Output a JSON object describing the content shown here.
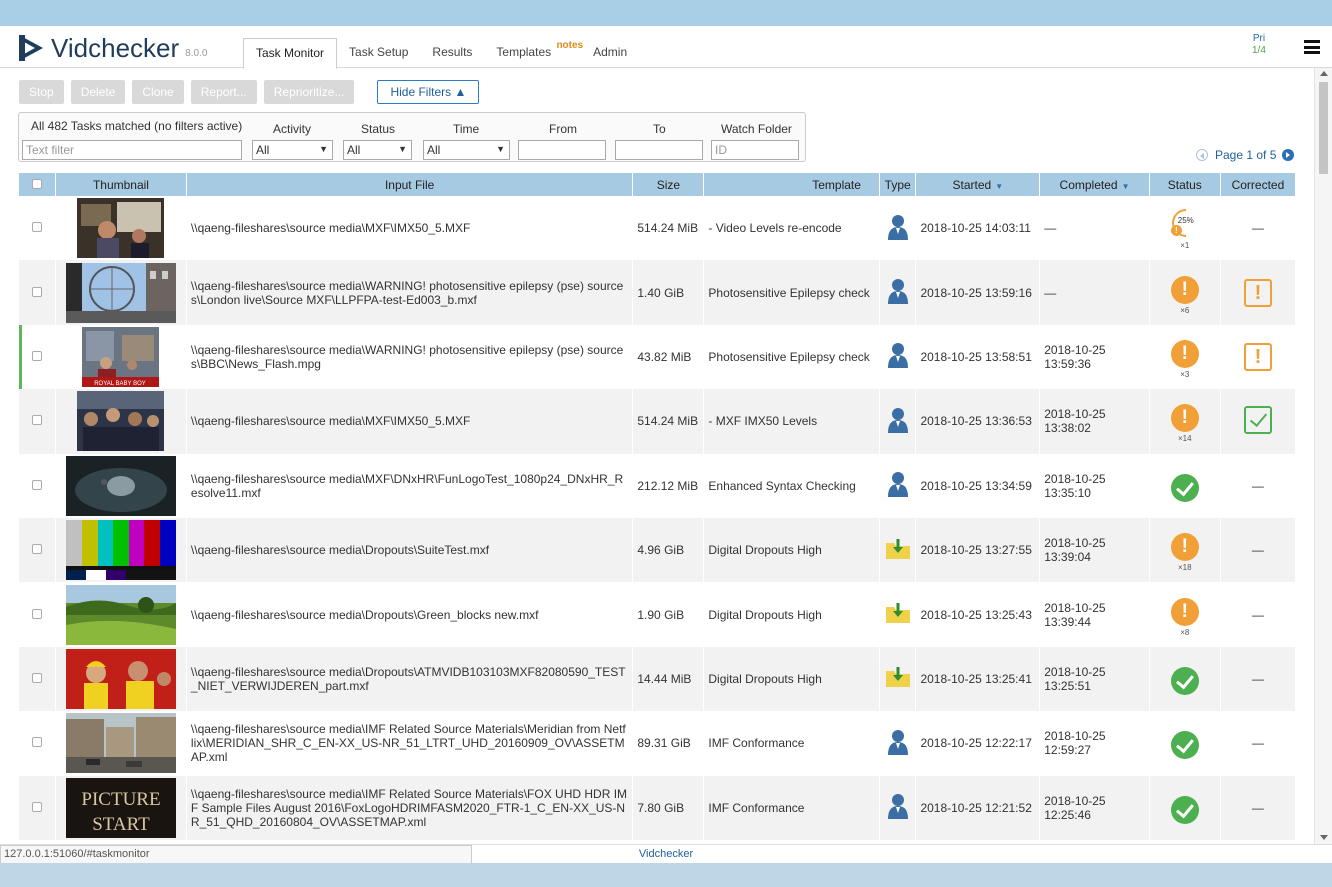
{
  "app": {
    "name": "Vidchecker",
    "version": "8.0.0",
    "priority_label": "Pri",
    "priority_value": "1/4"
  },
  "tabs": [
    {
      "label": "Task Monitor",
      "active": true
    },
    {
      "label": "Task Setup"
    },
    {
      "label": "Results"
    },
    {
      "label": "Templates",
      "badge": "notes"
    },
    {
      "label": "Admin"
    }
  ],
  "toolbar": {
    "stop": "Stop",
    "delete": "Delete",
    "clone": "Clone",
    "report": "Report...",
    "reprioritize": "Reprioritize...",
    "hide_filters": "Hide Filters ▲"
  },
  "filters": {
    "summary": "All 482 Tasks matched (no filters active)",
    "text_placeholder": "Text filter",
    "activity_label": "Activity",
    "activity_value": "All",
    "status_label": "Status",
    "status_value": "All",
    "time_label": "Time",
    "time_value": "All",
    "from_label": "From",
    "from_value": "",
    "to_label": "To",
    "to_value": "",
    "watch_folder_label": "Watch Folder",
    "watch_folder_placeholder": "ID"
  },
  "pager": {
    "text": "Page 1 of 5"
  },
  "columns": {
    "thumbnail": "Thumbnail",
    "input_file": "Input File",
    "size": "Size",
    "template": "Template",
    "type": "Type",
    "started": "Started",
    "completed": "Completed",
    "status": "Status",
    "corrected": "Corrected"
  },
  "rows": [
    {
      "file": "\\\\qaeng-fileshares\\source media\\MXF\\IMX50_5.MXF",
      "size": "514.24 MiB",
      "template": "- Video Levels re-encode",
      "type": "user",
      "started": "2018-10-25 14:03:11",
      "completed": "—",
      "status": "progress",
      "status_pct": "25%",
      "status_count": "×1",
      "corrected": "—",
      "thumb": "office"
    },
    {
      "file": "\\\\qaeng-fileshares\\source media\\WARNING! photosensitive epilepsy (pse) sources\\London live\\Source MXF\\LLPFPA-test-Ed003_b.mxf",
      "size": "1.40 GiB",
      "template": "Photosensitive Epilepsy check",
      "type": "user",
      "started": "2018-10-25 13:59:16",
      "completed": "—",
      "status": "warn",
      "status_count": "×6",
      "corrected": "warn",
      "thumb": "london"
    },
    {
      "file": "\\\\qaeng-fileshares\\source media\\WARNING! photosensitive epilepsy (pse) sources\\BBC\\News_Flash.mpg",
      "size": "43.82 MiB",
      "template": "Photosensitive Epilepsy check",
      "type": "user",
      "started": "2018-10-25 13:58:51",
      "completed": "2018-10-25 13:59:36",
      "status": "warn",
      "status_count": "×3",
      "corrected": "warn",
      "thumb": "news"
    },
    {
      "file": "\\\\qaeng-fileshares\\source media\\MXF\\IMX50_5.MXF",
      "size": "514.24 MiB",
      "template": "- MXF IMX50 Levels",
      "type": "user",
      "started": "2018-10-25 13:36:53",
      "completed": "2018-10-25 13:38:02",
      "status": "warn",
      "status_count": "×14",
      "corrected": "ok",
      "thumb": "crowd"
    },
    {
      "file": "\\\\qaeng-fileshares\\source media\\MXF\\DNxHR\\FunLogoTest_1080p24_DNxHR_Resolve11.mxf",
      "size": "212.12 MiB",
      "template": "Enhanced Syntax Checking",
      "type": "user",
      "started": "2018-10-25 13:34:59",
      "completed": "2018-10-25 13:35:10",
      "status": "ok",
      "status_count": "",
      "corrected": "—",
      "thumb": "dark"
    },
    {
      "file": "\\\\qaeng-fileshares\\source media\\Dropouts\\SuiteTest.mxf",
      "size": "4.96 GiB",
      "template": "Digital Dropouts High",
      "type": "folder",
      "started": "2018-10-25 13:27:55",
      "completed": "2018-10-25 13:39:04",
      "status": "warn",
      "status_count": "×18",
      "corrected": "—",
      "thumb": "bars"
    },
    {
      "file": "\\\\qaeng-fileshares\\source media\\Dropouts\\Green_blocks new.mxf",
      "size": "1.90 GiB",
      "template": "Digital Dropouts High",
      "type": "folder",
      "started": "2018-10-25 13:25:43",
      "completed": "2018-10-25 13:39:44",
      "status": "warn",
      "status_count": "×8",
      "corrected": "—",
      "thumb": "green"
    },
    {
      "file": "\\\\qaeng-fileshares\\source media\\Dropouts\\ATMVIDB103103MXF82080590_TEST_NIET_VERWIJDEREN_part.mxf",
      "size": "14.44 MiB",
      "template": "Digital Dropouts High",
      "type": "folder",
      "started": "2018-10-25 13:25:41",
      "completed": "2018-10-25 13:25:51",
      "status": "ok",
      "status_count": "",
      "corrected": "—",
      "thumb": "kids"
    },
    {
      "file": "\\\\qaeng-fileshares\\source media\\IMF Related Source Materials\\Meridian from Netflix\\MERIDIAN_SHR_C_EN-XX_US-NR_51_LTRT_UHD_20160909_OV\\ASSETMAP.xml",
      "size": "89.31 GiB",
      "template": "IMF Conformance",
      "type": "user",
      "started": "2018-10-25 12:22:17",
      "completed": "2018-10-25 12:59:27",
      "status": "ok",
      "status_count": "",
      "corrected": "—",
      "thumb": "street"
    },
    {
      "file": "\\\\qaeng-fileshares\\source media\\IMF Related Source Materials\\FOX UHD HDR IMF Sample Files August 2016\\FoxLogoHDRIMFASM2020_FTR-1_C_EN-XX_US-NR_51_QHD_20160804_OV\\ASSETMAP.xml",
      "size": "7.80 GiB",
      "template": "IMF Conformance",
      "type": "user",
      "started": "2018-10-25 12:21:52",
      "completed": "2018-10-25 12:25:46",
      "status": "ok",
      "status_count": "",
      "corrected": "—",
      "thumb": "picture",
      "thumb_text": "PICTURE START"
    }
  ],
  "statusbar": {
    "url": "127.0.0.1:51060/#taskmonitor",
    "app_name": "Vidchecker"
  },
  "colors": {
    "header_blue": "#a7cae3",
    "warn_orange": "#f0a036",
    "ok_green": "#4caf50",
    "link_blue": "#1f5f9a"
  }
}
